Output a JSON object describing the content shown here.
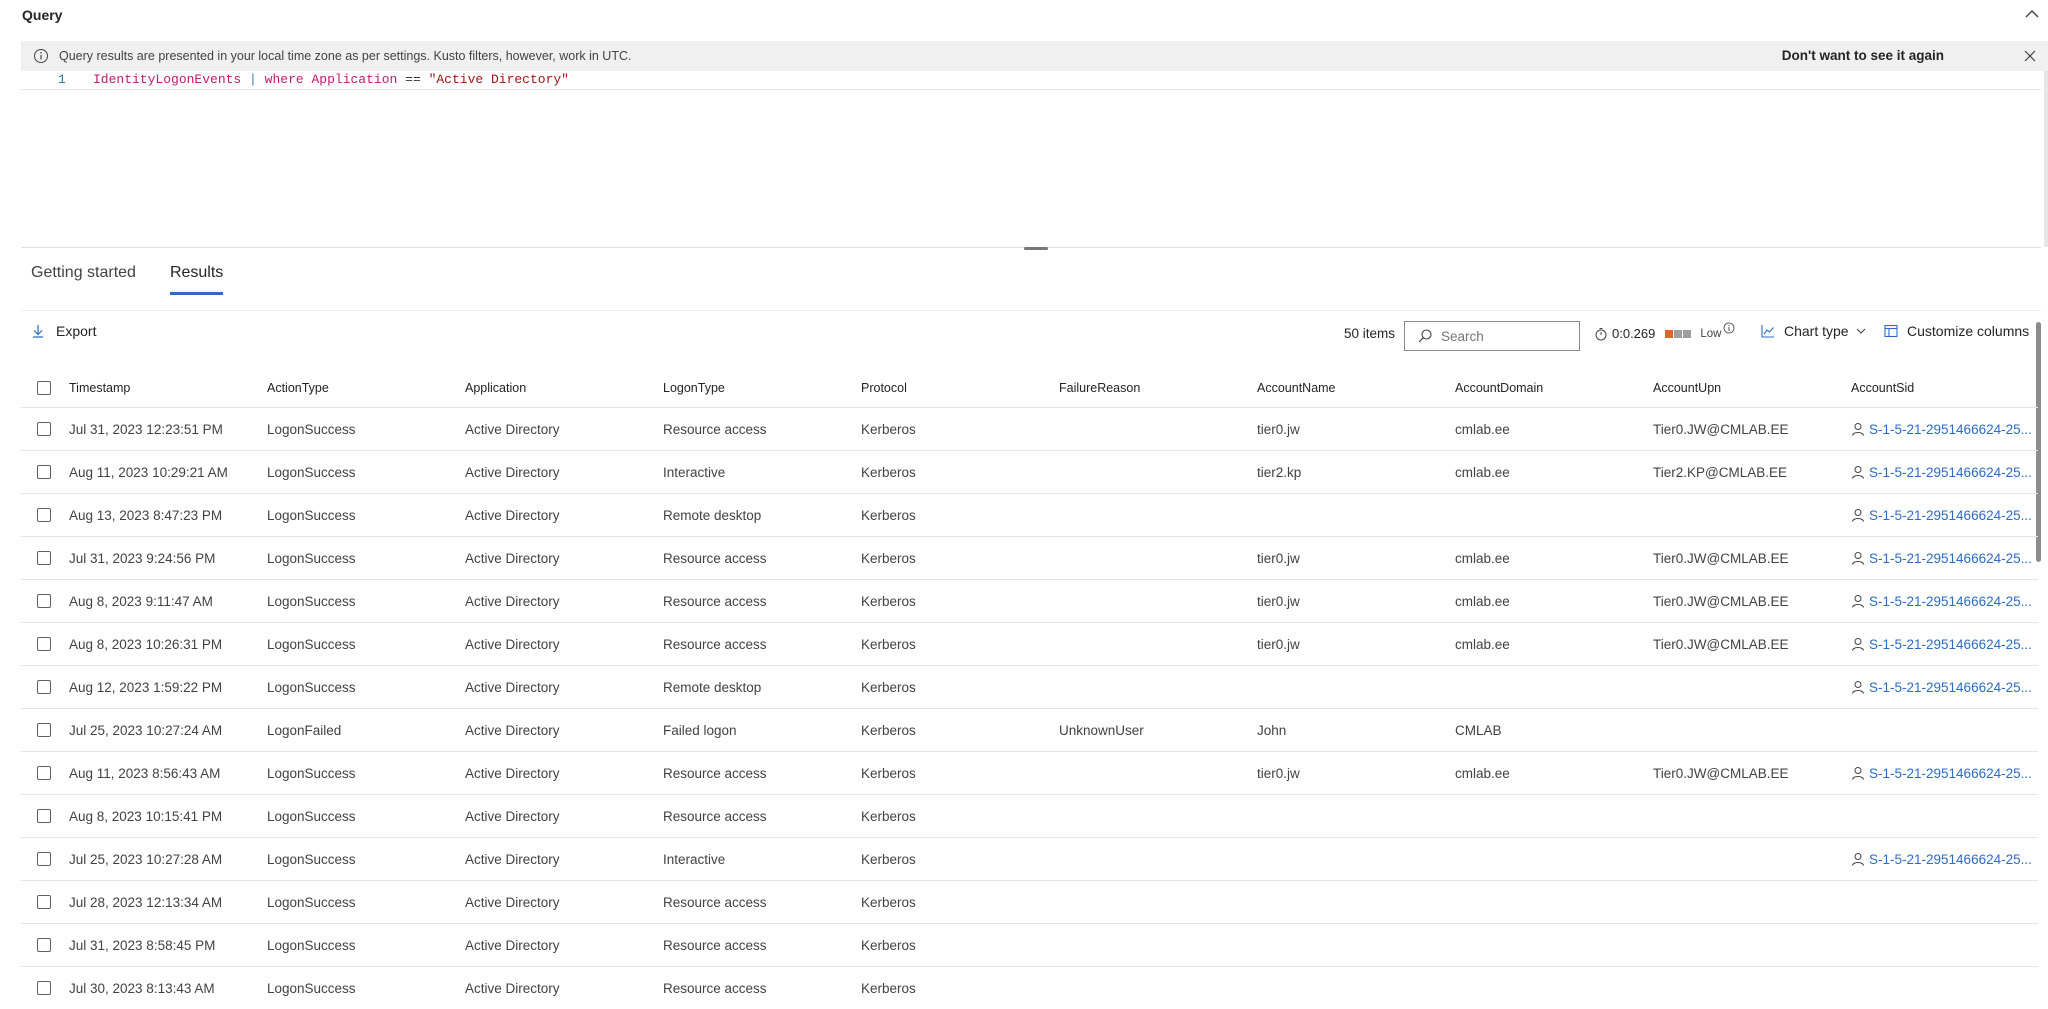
{
  "query_header": {
    "title": "Query"
  },
  "infobar": {
    "message": "Query results are presented in your local time zone as per settings. Kusto filters, however, work in UTC.",
    "dismiss_label": "Don't want to see it again"
  },
  "editor": {
    "line_number": "1",
    "tokens": {
      "table": "IdentityLogonEvents",
      "pipe": "|",
      "keyword": "where",
      "column": "Application",
      "operator": "==",
      "value": "\"Active Directory\""
    }
  },
  "tabs": [
    {
      "label": "Getting started",
      "active": false
    },
    {
      "label": "Results",
      "active": true
    }
  ],
  "toolbar": {
    "export_label": "Export",
    "items_count": "50 items",
    "search_placeholder": "Search",
    "exec_time": "0:0.269",
    "resource_usage": "Low",
    "chart_type_label": "Chart type",
    "customize_label": "Customize columns"
  },
  "colors": {
    "accent": "#2b6cc4",
    "load_high": "#e0642b",
    "load_low": "#9e9e9e"
  },
  "table": {
    "columns": [
      "Timestamp",
      "ActionType",
      "Application",
      "LogonType",
      "Protocol",
      "FailureReason",
      "AccountName",
      "AccountDomain",
      "AccountUpn",
      "AccountSid"
    ],
    "rows": [
      [
        "Jul 31, 2023 12:23:51 PM",
        "LogonSuccess",
        "Active Directory",
        "Resource access",
        "Kerberos",
        "",
        "tier0.jw",
        "cmlab.ee",
        "Tier0.JW@CMLAB.EE",
        "S-1-5-21-2951466624-25..."
      ],
      [
        "Aug 11, 2023 10:29:21 AM",
        "LogonSuccess",
        "Active Directory",
        "Interactive",
        "Kerberos",
        "",
        "tier2.kp",
        "cmlab.ee",
        "Tier2.KP@CMLAB.EE",
        "S-1-5-21-2951466624-25..."
      ],
      [
        "Aug 13, 2023 8:47:23 PM",
        "LogonSuccess",
        "Active Directory",
        "Remote desktop",
        "Kerberos",
        "",
        "",
        "",
        "",
        "S-1-5-21-2951466624-25..."
      ],
      [
        "Jul 31, 2023 9:24:56 PM",
        "LogonSuccess",
        "Active Directory",
        "Resource access",
        "Kerberos",
        "",
        "tier0.jw",
        "cmlab.ee",
        "Tier0.JW@CMLAB.EE",
        "S-1-5-21-2951466624-25..."
      ],
      [
        "Aug 8, 2023 9:11:47 AM",
        "LogonSuccess",
        "Active Directory",
        "Resource access",
        "Kerberos",
        "",
        "tier0.jw",
        "cmlab.ee",
        "Tier0.JW@CMLAB.EE",
        "S-1-5-21-2951466624-25..."
      ],
      [
        "Aug 8, 2023 10:26:31 PM",
        "LogonSuccess",
        "Active Directory",
        "Resource access",
        "Kerberos",
        "",
        "tier0.jw",
        "cmlab.ee",
        "Tier0.JW@CMLAB.EE",
        "S-1-5-21-2951466624-25..."
      ],
      [
        "Aug 12, 2023 1:59:22 PM",
        "LogonSuccess",
        "Active Directory",
        "Remote desktop",
        "Kerberos",
        "",
        "",
        "",
        "",
        "S-1-5-21-2951466624-25..."
      ],
      [
        "Jul 25, 2023 10:27:24 AM",
        "LogonFailed",
        "Active Directory",
        "Failed logon",
        "Kerberos",
        "UnknownUser",
        "John",
        "CMLAB",
        "",
        ""
      ],
      [
        "Aug 11, 2023 8:56:43 AM",
        "LogonSuccess",
        "Active Directory",
        "Resource access",
        "Kerberos",
        "",
        "tier0.jw",
        "cmlab.ee",
        "Tier0.JW@CMLAB.EE",
        "S-1-5-21-2951466624-25..."
      ],
      [
        "Aug 8, 2023 10:15:41 PM",
        "LogonSuccess",
        "Active Directory",
        "Resource access",
        "Kerberos",
        "",
        "",
        "",
        "",
        ""
      ],
      [
        "Jul 25, 2023 10:27:28 AM",
        "LogonSuccess",
        "Active Directory",
        "Interactive",
        "Kerberos",
        "",
        "",
        "",
        "",
        "S-1-5-21-2951466624-25..."
      ],
      [
        "Jul 28, 2023 12:13:34 AM",
        "LogonSuccess",
        "Active Directory",
        "Resource access",
        "Kerberos",
        "",
        "",
        "",
        "",
        ""
      ],
      [
        "Jul 31, 2023 8:58:45 PM",
        "LogonSuccess",
        "Active Directory",
        "Resource access",
        "Kerberos",
        "",
        "",
        "",
        "",
        ""
      ],
      [
        "Jul 30, 2023 8:13:43 AM",
        "LogonSuccess",
        "Active Directory",
        "Resource access",
        "Kerberos",
        "",
        "",
        "",
        "",
        ""
      ]
    ]
  }
}
